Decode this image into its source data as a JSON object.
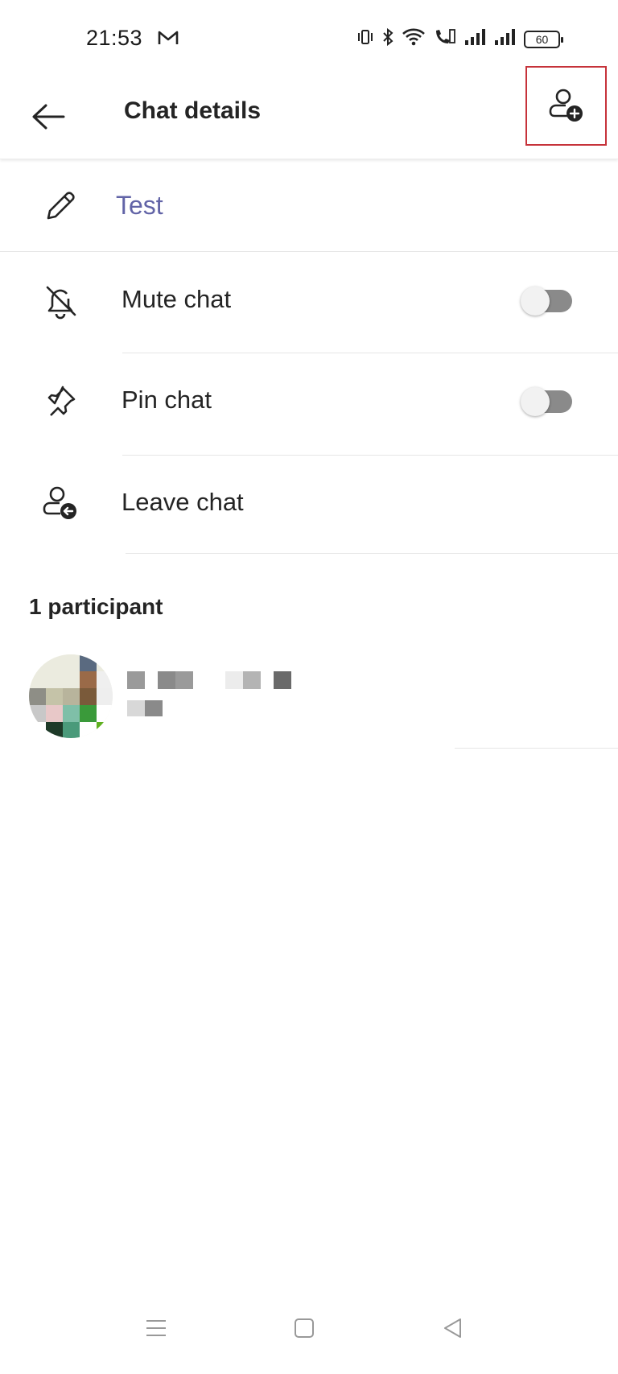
{
  "status_bar": {
    "time": "21:53",
    "battery": "60",
    "icons": [
      "gmail-icon",
      "vibrate-icon",
      "bluetooth-icon",
      "wifi-icon",
      "wifi-calling-icon",
      "signal-icon",
      "signal-icon",
      "battery-icon"
    ]
  },
  "app_bar": {
    "title": "Chat details",
    "back_icon": "arrow-left-icon",
    "add_people_icon": "person-add-icon",
    "highlight_color": "#c6323a"
  },
  "chat_name": {
    "value": "Test",
    "icon": "pencil-icon",
    "color": "#6264a7"
  },
  "settings": [
    {
      "label": "Mute chat",
      "icon": "bell-off-icon",
      "toggle": false
    },
    {
      "label": "Pin chat",
      "icon": "pin-icon",
      "toggle": false
    },
    {
      "label": "Leave chat",
      "icon": "person-leave-icon"
    }
  ],
  "participants": {
    "header": "1 participant"
  },
  "nav_bar": {
    "icons": [
      "menu-icon",
      "home-icon",
      "back-triangle-icon"
    ]
  }
}
